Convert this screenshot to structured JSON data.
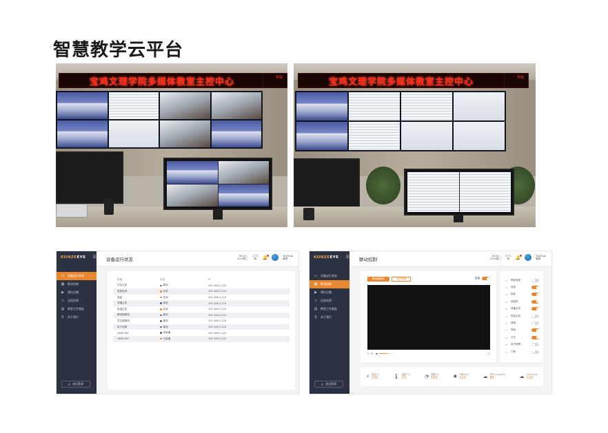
{
  "page": {
    "title": "智慧教学云平台"
  },
  "photos": {
    "left": {
      "banner": "宝鸡文理学院多媒体教室主控中心",
      "emblem": "学院"
    },
    "right": {
      "banner": "宝鸡文理学院多媒体教室主控中心",
      "emblem": "学院"
    }
  },
  "app_common": {
    "logo_main": "KONZE",
    "logo_sub": "EYE",
    "nav": [
      {
        "label": "设备运行状态",
        "icon": "monitor-icon"
      },
      {
        "label": "联动控制",
        "icon": "grid-icon"
      },
      {
        "label": "预约点播",
        "icon": "play-icon"
      },
      {
        "label": "远程巡视",
        "icon": "wave-icon"
      },
      {
        "label": "教室工作看板",
        "icon": "board-icon"
      },
      {
        "label": "关于我们",
        "icon": "info-icon"
      }
    ],
    "logout": "退出登录",
    "date_line1": "06-02",
    "date_line2": "2019周二",
    "weather_line1": "11°C",
    "weather_line2": "晴",
    "user_line1": "YanZhao",
    "user_line2": "管理"
  },
  "device_status": {
    "heading": "设备运行状态",
    "headers": [
      "设备",
      "状态",
      "IP"
    ],
    "rows": [
      {
        "name": "中控主机",
        "status": "离线",
        "color": "#5b6478",
        "ip": "192.168.1.210"
      },
      {
        "name": "智能电源",
        "status": "在线",
        "color": "#e8872f",
        "ip": "192.168.1.210"
      },
      {
        "name": "电脑",
        "status": "在线",
        "color": "#e8872f",
        "ip": "192.168.1.210"
      },
      {
        "name": "录播主机",
        "status": "离线",
        "color": "#5b6478",
        "ip": "192.168.1.210"
      },
      {
        "name": "防盗主机",
        "status": "在线",
        "color": "#e8872f",
        "ip": "192.168.1.210"
      },
      {
        "name": "教师摄像机",
        "status": "离线",
        "color": "#5b6478",
        "ip": "192.168.1.210"
      },
      {
        "name": "学生摄像机",
        "status": "离线",
        "color": "#5b6478",
        "ip": "192.168.1.210"
      },
      {
        "name": "电子班牌",
        "status": "离线",
        "color": "#5b6478",
        "ip": "192.168.1.210"
      },
      {
        "name": "HDMI IN1",
        "status": "未接通",
        "color": "#5b6478",
        "ip": "192.168.1.210"
      },
      {
        "name": "HDMI IN2",
        "status": "已接通",
        "color": "#e8872f",
        "ip": "192.168.1.210"
      }
    ]
  },
  "linkage": {
    "heading": "联动控制",
    "tabs": [
      "教师摄像机",
      "学生摄像"
    ],
    "live_label": "直播",
    "progress": 0.6,
    "switches": [
      {
        "label": "教室电源",
        "on": false
      },
      {
        "label": "系统",
        "on": true
      },
      {
        "label": "投影",
        "on": true
      },
      {
        "label": "投影机",
        "on": true
      },
      {
        "label": "录播主机",
        "on": true
      },
      {
        "label": "防盗主机",
        "on": false
      },
      {
        "label": "音响",
        "on": false
      },
      {
        "label": "风扇",
        "on": true
      },
      {
        "label": "灯光",
        "on": true
      },
      {
        "label": "电子班牌",
        "on": false
      },
      {
        "label": "门禁",
        "on": false
      }
    ],
    "sensors": [
      {
        "label": "电压(V)",
        "value": "220",
        "icon": "bolt-icon",
        "glyph": "⚡"
      },
      {
        "label": "温度(°C)",
        "value": "23",
        "icon": "thermometer-icon",
        "glyph": "🌡"
      },
      {
        "label": "湿度(%)",
        "value": "163",
        "icon": "humidity-icon",
        "glyph": "◔"
      },
      {
        "label": "光照(lux)",
        "value": "110",
        "icon": "light-icon",
        "glyph": "✺"
      },
      {
        "label": "PM2.5(ug/m3)",
        "value": "88",
        "icon": "pm-icon",
        "glyph": "☁"
      },
      {
        "label": "CO2(ppm)",
        "value": "120",
        "icon": "co2-icon",
        "glyph": "☁"
      }
    ]
  }
}
